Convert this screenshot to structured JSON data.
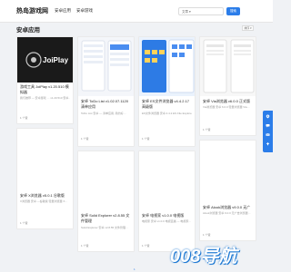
{
  "header": {
    "logo": "热岛游戏网",
    "nav": [
      "安卓应用",
      "安卓游戏"
    ],
    "search_select": "文章 ▾",
    "search_placeholder": "",
    "search_button": "搜索"
  },
  "section": {
    "title": "安卓应用",
    "sort_label": "排序 ▾"
  },
  "cards": [
    {
      "title": "游戏工具 JoiPlay v1.20.510 模拟器",
      "desc": "我们推荐 — 安卓游戏 … v1.20.510 安卓…",
      "meta": "1 个赞",
      "thumb_text": "JoiPlay"
    },
    {
      "title": "安卓 ToDo List v1.02.07.1120 清单应用",
      "desc": "ToDo List 安卓 — 清单应用, 简约好…",
      "meta": "1 个赞"
    },
    {
      "title": "安卓 ES文件浏览器 v4.4.2.17 高级版",
      "desc": "ES文件浏览器 安卓 4.4.2 ES File Explorer…",
      "meta": "1 个赞"
    },
    {
      "title": "安卓 Via浏览器 v6.0.0 正式版",
      "desc": "Via浏览器 安卓 6.0.0 轻量浏览器 Via…",
      "meta": "1 个赞"
    },
    {
      "title": "安卓 X浏览器 v5.0.1 谷歌版",
      "desc": "X浏览器 安卓 —谷歌版 轻量浏览器 X…",
      "meta": "1 个赞"
    },
    {
      "title": "安卓 Solid Explorer v2.8.55 文件管理",
      "desc": "Solid Explorer 安卓 v2.8.55 文件管理…",
      "meta": "1 个赞"
    },
    {
      "title": "安卓 电视家 v1.0.0 电视版",
      "desc": "电视家 安卓 v1.0.0 电视直播 — 电视家…",
      "meta": "1 个赞"
    },
    {
      "title": "安卓 Alook浏览器 v9.0.0 无广告",
      "desc": "Alook浏览器 安卓 9.0.0 无广告浏览器…",
      "meta": "1 个赞"
    }
  ],
  "watermark": "008导航",
  "pager": "1",
  "colors": {
    "accent": "#2b7de9",
    "background": "#f0f2f5"
  }
}
